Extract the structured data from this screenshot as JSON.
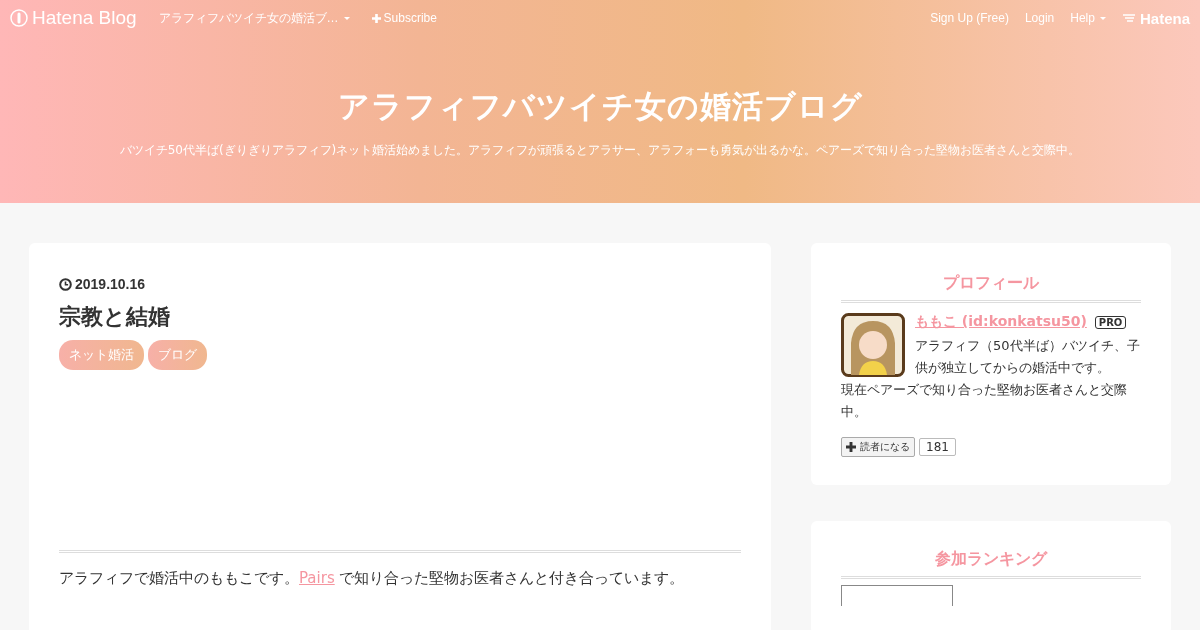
{
  "nav": {
    "logo": "Hatena Blog",
    "blog_menu": "アラフィフバツイチ女の婚活ブ…",
    "subscribe": "Subscribe",
    "links": [
      "Sign Up (Free)",
      "Login"
    ],
    "help": "Help",
    "brand": "Hatena"
  },
  "header": {
    "title": "アラフィフバツイチ女の婚活ブログ",
    "description": "バツイチ50代半ば(ぎりぎりアラフィフ)ネット婚活始めました。アラフィフが頑張るとアラサー、アラフォーも勇気が出るかな。ペアーズで知り合った堅物お医者さんと交際中。"
  },
  "article": {
    "date": "2019.10.16",
    "title": "宗教と結婚",
    "tags": [
      "ネット婚活",
      "ブログ"
    ],
    "body": {
      "before": "アラフィフで婚活中のももこです。",
      "link": "Pairs",
      "after": " で知り合った堅物お医者さんと付き合っています。"
    }
  },
  "sidebar": [
    {
      "kind": "profile",
      "heading": "プロフィール",
      "name": "ももこ (id:konkatsu50)",
      "badge": "PRO",
      "bio": [
        "アラフィフ（50代半ば）バツイチ、子供が独立してからの婚活中です。",
        "現在ペアーズで知り合った堅物お医者さんと交際中。"
      ],
      "follow": "読者になる",
      "count": "181"
    },
    {
      "kind": "ranking",
      "heading": "参加ランキング"
    }
  ]
}
